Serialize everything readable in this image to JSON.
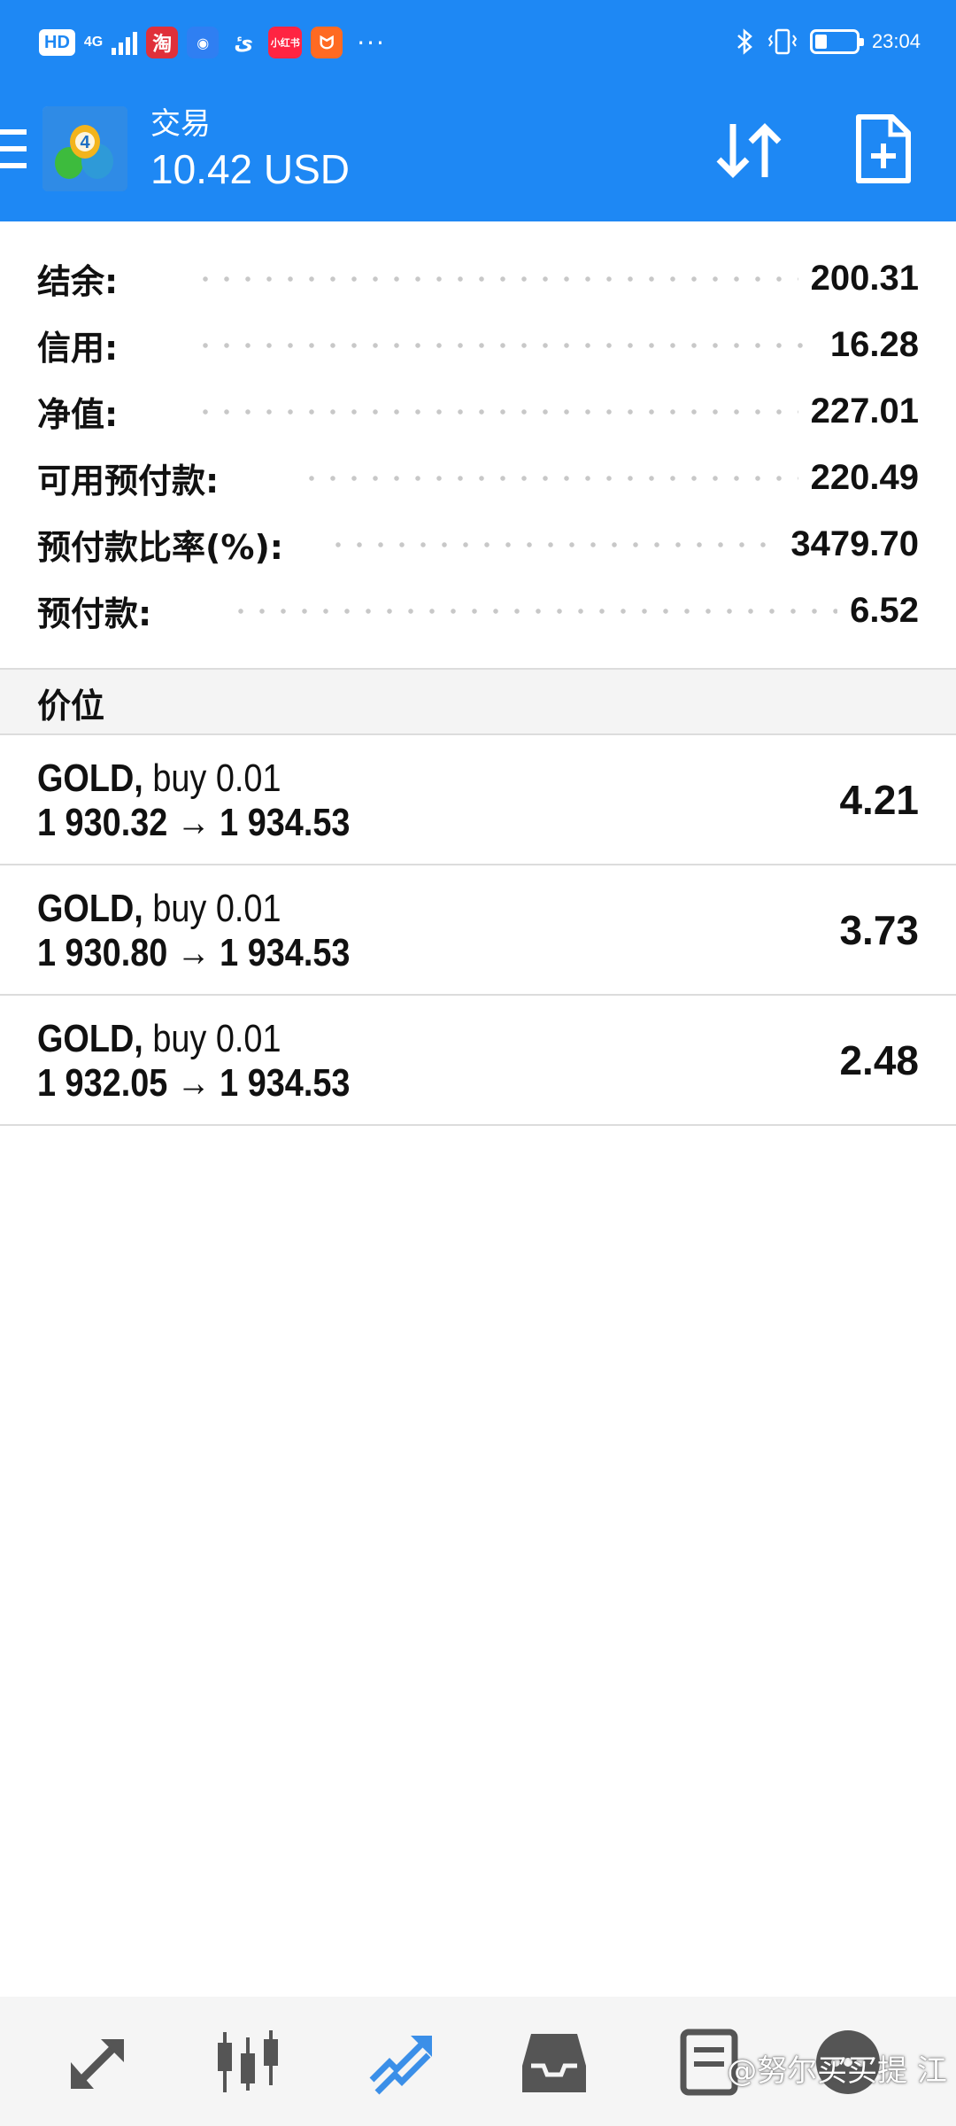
{
  "status_bar": {
    "hd": "HD",
    "network": "4G",
    "apps": [
      "淘",
      "小红书"
    ],
    "more": "···",
    "time": "23:04",
    "battery_level": 0.3
  },
  "header": {
    "title": "交易",
    "profit": "10.42 USD"
  },
  "summary": [
    {
      "label": "结余:",
      "value": "200.31"
    },
    {
      "label": "信用:",
      "value": "16.28"
    },
    {
      "label": "净值:",
      "value": "227.01"
    },
    {
      "label": "可用预付款:",
      "value": "220.49"
    },
    {
      "label": "预付款比率(%):",
      "value": "3479.70"
    },
    {
      "label": "预付款:",
      "value": "6.52"
    }
  ],
  "section_title": "价位",
  "positions": [
    {
      "symbol": "GOLD,",
      "side": " buy 0.01",
      "prices": "1 930.32 → 1 934.53",
      "profit": "4.21"
    },
    {
      "symbol": "GOLD,",
      "side": " buy 0.01",
      "prices": "1 930.80 → 1 934.53",
      "profit": "3.73"
    },
    {
      "symbol": "GOLD,",
      "side": " buy 0.01",
      "prices": "1 932.05 → 1 934.53",
      "profit": "2.48"
    }
  ],
  "bottom_nav": [
    {
      "icon": "quotes-icon",
      "active": false
    },
    {
      "icon": "chart-icon",
      "active": false
    },
    {
      "icon": "trade-icon",
      "active": true
    },
    {
      "icon": "history-icon",
      "active": false
    },
    {
      "icon": "news-icon",
      "active": false
    },
    {
      "icon": "chat-icon",
      "active": false
    }
  ],
  "watermark": "@努尔买买提 江",
  "colors": {
    "primary": "#1e88f4",
    "active_nav": "#3b8fe8",
    "inactive_nav": "#555555"
  }
}
